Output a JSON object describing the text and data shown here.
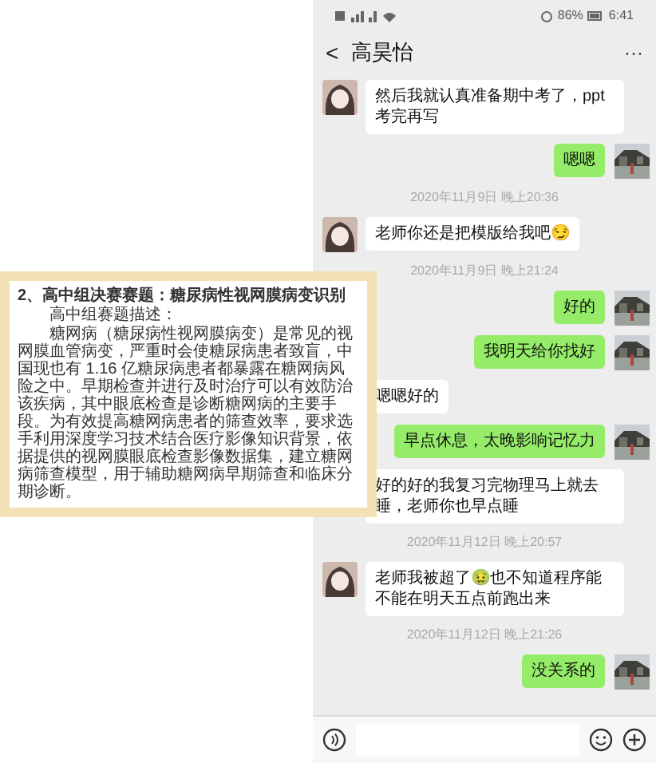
{
  "status_bar": {
    "battery": "86%",
    "time": "6:41"
  },
  "header": {
    "back": "<",
    "title": "高昊怡",
    "more": "···"
  },
  "messages": [
    {
      "kind": "in",
      "text": "然后我就认真准备期中考了，ppt考完再写"
    },
    {
      "kind": "out",
      "text": "嗯嗯"
    },
    {
      "kind": "time",
      "text": "2020年11月9日 晚上20:36"
    },
    {
      "kind": "in",
      "text": "老师你还是把模版给我吧😏"
    },
    {
      "kind": "time",
      "text": "2020年11月9日 晚上21:24"
    },
    {
      "kind": "out",
      "text": "好的"
    },
    {
      "kind": "out",
      "text": "我明天给你找好"
    },
    {
      "kind": "in",
      "text": "嗯嗯好的"
    },
    {
      "kind": "out",
      "text": "早点休息，太晚影响记忆力"
    },
    {
      "kind": "in",
      "text": "好的好的我复习完物理马上就去睡，老师你也早点睡"
    },
    {
      "kind": "time",
      "text": "2020年11月12日 晚上20:57"
    },
    {
      "kind": "in",
      "text": "老师我被超了🤢也不知道程序能不能在明天五点前跑出来"
    },
    {
      "kind": "time",
      "text": "2020年11月12日 晚上21:26"
    },
    {
      "kind": "out",
      "text": "没关系的"
    }
  ],
  "document": {
    "heading": "2、高中组决赛赛题：糖尿病性视网膜病变识别",
    "subheading": "高中组赛题描述：",
    "body": "糖网病（糖尿病性视网膜病变）是常见的视网膜血管病变，严重时会使糖尿病患者致盲，中国现也有 1.16 亿糖尿病患者都暴露在糖网病风险之中。早期检查并进行及时治疗可以有效防治该疾病，其中眼底检查是诊断糖网病的主要手段。为有效提高糖网病患者的筛查效率，要求选手利用深度学习技术结合医疗影像知识背景，依据提供的视网膜眼底检查影像数据集，建立糖网病筛查模型，用于辅助糖网病早期筛查和临床分期诊断。"
  }
}
